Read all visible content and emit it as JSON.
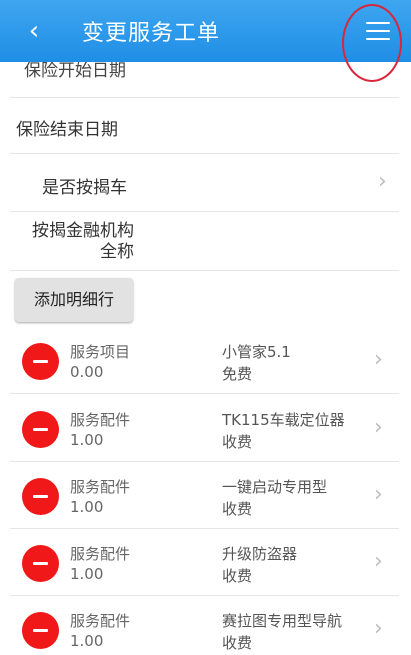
{
  "header": {
    "back_icon": "‹",
    "title": "变更服务工单",
    "menu_icon": "hamburger-menu-icon"
  },
  "form": {
    "insurance_start_label": "保险开始日期",
    "insurance_end_label": "保险结束日期",
    "mortgage_label": "是否按揭车",
    "institution_label_line1": "按揭金融机构",
    "institution_label_line2": "全称",
    "add_detail_button": "添加明细行"
  },
  "items": [
    {
      "type": "服务项目",
      "qty": "0.00",
      "name": "小管家5.1",
      "fee": "免费"
    },
    {
      "type": "服务配件",
      "qty": "1.00",
      "name": "TK115车载定位器",
      "fee": "收费"
    },
    {
      "type": "服务配件",
      "qty": "1.00",
      "name": "一键启动专用型",
      "fee": "收费"
    },
    {
      "type": "服务配件",
      "qty": "1.00",
      "name": "升级防盗器",
      "fee": "收费"
    },
    {
      "type": "服务配件",
      "qty": "1.00",
      "name": "赛拉图专用型导航",
      "fee": "收费"
    }
  ],
  "colors": {
    "header": "#1f8ee6",
    "delete": "#f01818",
    "annotation": "#d8263a"
  }
}
